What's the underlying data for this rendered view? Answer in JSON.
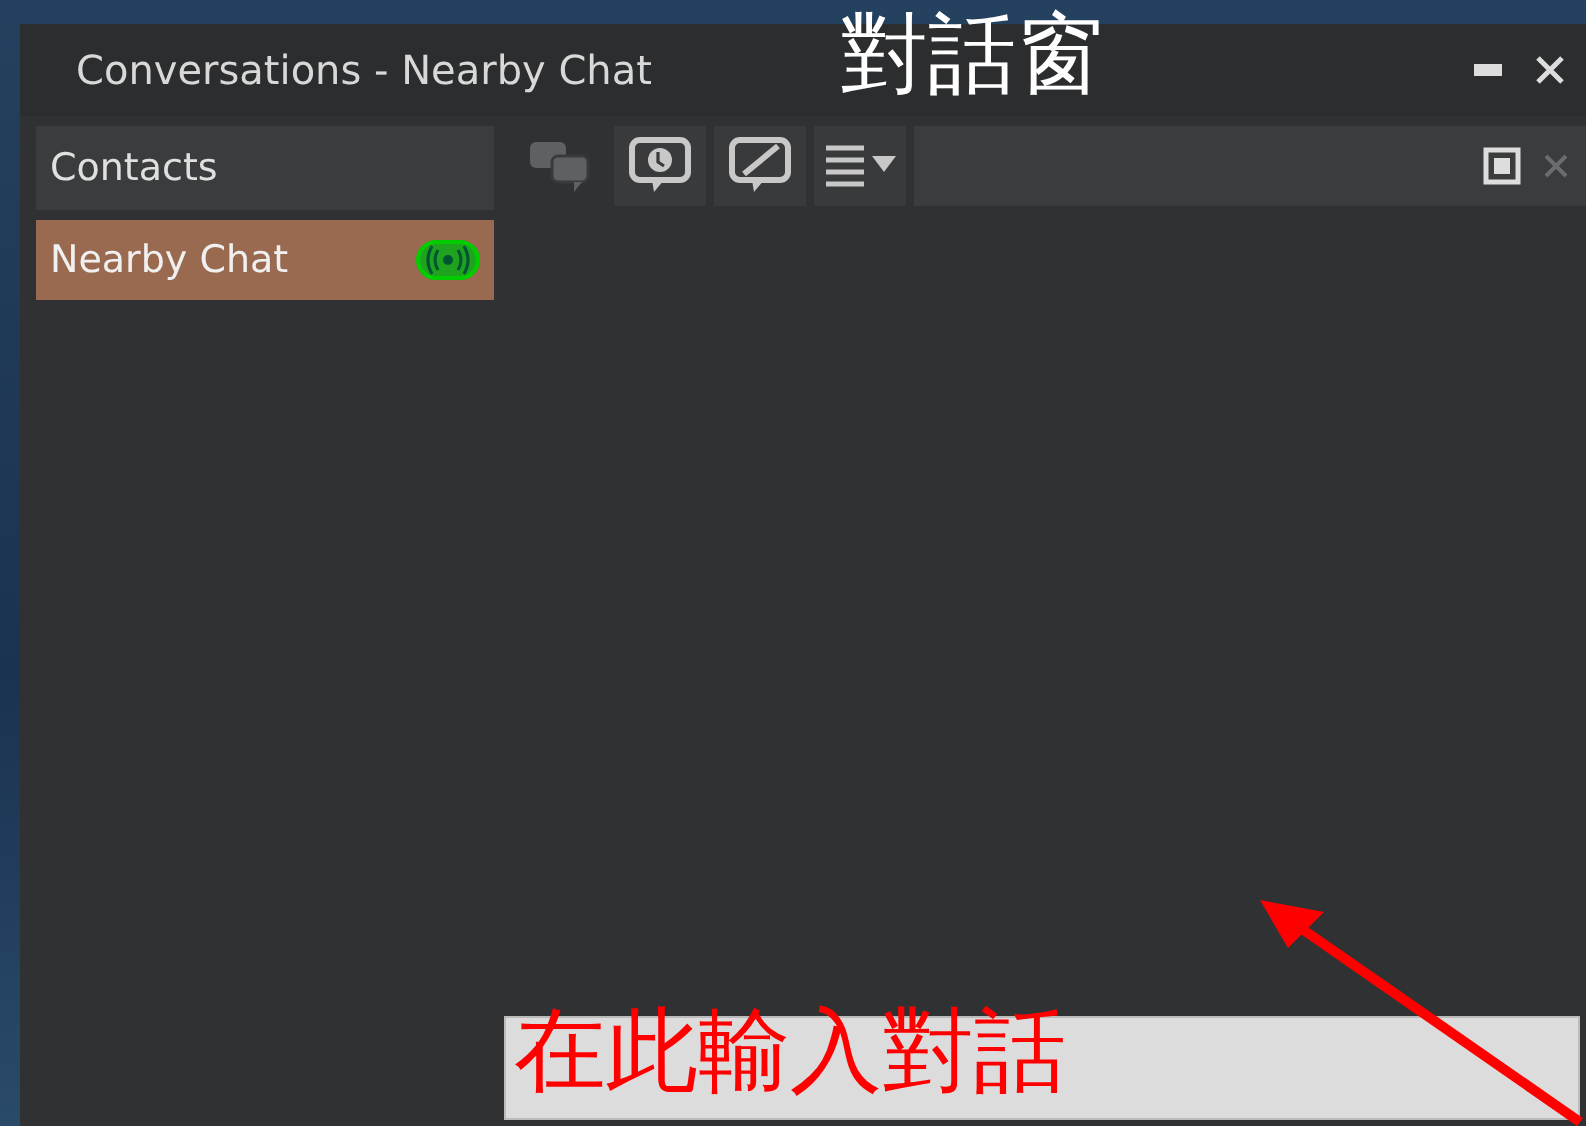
{
  "window": {
    "title": "Conversations - Nearby Chat"
  },
  "sidebar": {
    "header": "Contacts",
    "items": [
      {
        "label": "Nearby Chat",
        "selected": true,
        "kind": "nearby"
      }
    ]
  },
  "toolbar": {
    "buttons": [
      {
        "kind": "people",
        "disabled": true
      },
      {
        "kind": "call",
        "disabled": false
      },
      {
        "kind": "end-call",
        "disabled": false
      },
      {
        "kind": "menu",
        "disabled": false
      }
    ]
  },
  "chat_input": {
    "kind": "text"
  },
  "annotations": [
    {
      "kind": "title",
      "text": "對話窗"
    },
    {
      "kind": "label",
      "text": "在此輸入對話"
    },
    {
      "kind": "arrow"
    }
  ]
}
